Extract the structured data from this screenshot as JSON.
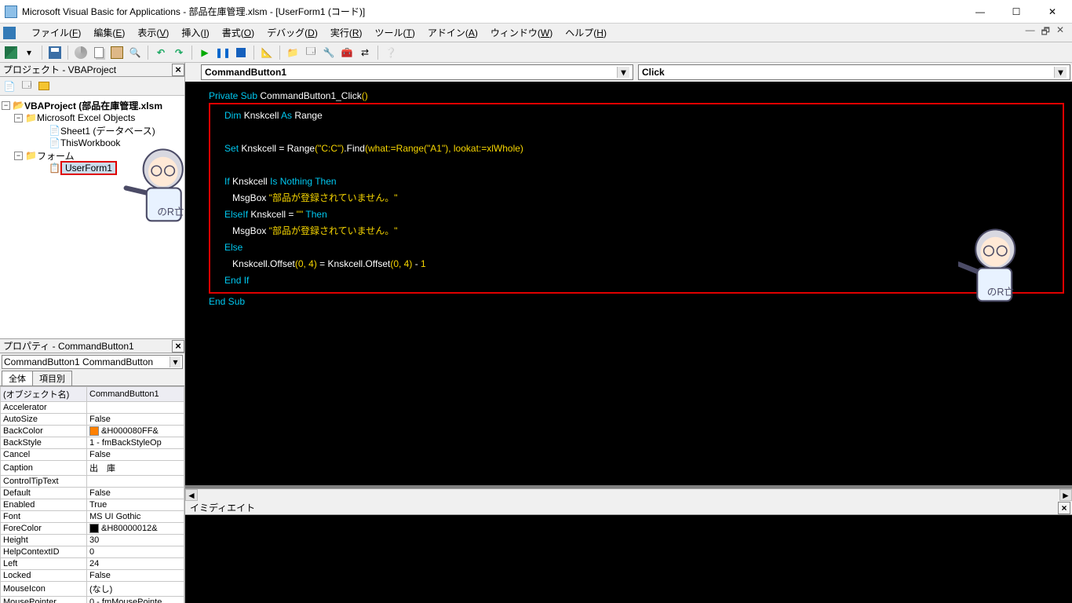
{
  "title": "Microsoft Visual Basic for Applications - 部品在庫管理.xlsm - [UserForm1 (コード)]",
  "menu": {
    "file": {
      "label": "ファイル",
      "accel": "F"
    },
    "edit": {
      "label": "編集",
      "accel": "E"
    },
    "view": {
      "label": "表示",
      "accel": "V"
    },
    "insert": {
      "label": "挿入",
      "accel": "I"
    },
    "format": {
      "label": "書式",
      "accel": "O"
    },
    "debug": {
      "label": "デバッグ",
      "accel": "D"
    },
    "run": {
      "label": "実行",
      "accel": "R"
    },
    "tools": {
      "label": "ツール",
      "accel": "T"
    },
    "addin": {
      "label": "アドイン",
      "accel": "A"
    },
    "window": {
      "label": "ウィンドウ",
      "accel": "W"
    },
    "help": {
      "label": "ヘルプ",
      "accel": "H"
    }
  },
  "project_pane": {
    "title": "プロジェクト - VBAProject",
    "root": "VBAProject (部品在庫管理.xlsm",
    "folder_excel": "Microsoft Excel Objects",
    "sheet1": "Sheet1 (データベース)",
    "thiswb": "ThisWorkbook",
    "folder_forms": "フォーム",
    "userform1": "UserForm1"
  },
  "properties_pane": {
    "title": "プロパティ - CommandButton1",
    "type_selector": "CommandButton1 CommandButton",
    "tab_all": "全体",
    "tab_cat": "項目別",
    "rows": [
      {
        "k": "(オブジェクト名)",
        "v": "CommandButton1"
      },
      {
        "k": "Accelerator",
        "v": ""
      },
      {
        "k": "AutoSize",
        "v": "False"
      },
      {
        "k": "BackColor",
        "v": "&H000080FF&",
        "chip": "#ff8000"
      },
      {
        "k": "BackStyle",
        "v": "1 - fmBackStyleOp"
      },
      {
        "k": "Cancel",
        "v": "False"
      },
      {
        "k": "Caption",
        "v": "出　庫"
      },
      {
        "k": "ControlTipText",
        "v": ""
      },
      {
        "k": "Default",
        "v": "False"
      },
      {
        "k": "Enabled",
        "v": "True"
      },
      {
        "k": "Font",
        "v": "MS UI Gothic"
      },
      {
        "k": "ForeColor",
        "v": "&H80000012&",
        "chip": "#000000"
      },
      {
        "k": "Height",
        "v": "30"
      },
      {
        "k": "HelpContextID",
        "v": "0"
      },
      {
        "k": "Left",
        "v": "24"
      },
      {
        "k": "Locked",
        "v": "False"
      },
      {
        "k": "MouseIcon",
        "v": "(なし)"
      },
      {
        "k": "MousePointer",
        "v": "0 - fmMousePointe"
      }
    ]
  },
  "code_dropdown": {
    "left": "CommandButton1",
    "right": "Click"
  },
  "code": {
    "l1_kw": "Private Sub",
    "l1_rest": "CommandButton1_Click",
    "l1_paren": "()",
    "l2_dim": "Dim",
    "l2_var": "Knskcell",
    "l2_as": "As",
    "l2_type": "Range",
    "l3_set": "Set",
    "l3_lhs": "Knskcell = Range",
    "l3_arg1": "(\"C:C\")",
    "l3_find": ".Find",
    "l3_arg2": "(what:=Range(\"A1\"), lookat:=xlWhole)",
    "l4_if": "If",
    "l4_cond": "Knskcell",
    "l4_is": "Is Nothing Then",
    "l5_msg": "MsgBox",
    "l5_str": "\"部品が登録されていません。\"",
    "l6_elseif": "ElseIf",
    "l6_cond": "Knskcell =",
    "l6_str": "\"\"",
    "l6_then": "Then",
    "l7_msg": "MsgBox",
    "l7_str": "\"部品が登録されていません。\"",
    "l8_else": "Else",
    "l9_lhs": "Knskcell.Offset",
    "l9_a1": "(0, 4)",
    "l9_eq": " = Knskcell.Offset",
    "l9_a2": "(0, 4)",
    "l9_minus": " - ",
    "l9_one": "1",
    "l10_endif": "End If",
    "l11_endsub": "End Sub"
  },
  "immediate": {
    "title": "イミディエイト"
  }
}
